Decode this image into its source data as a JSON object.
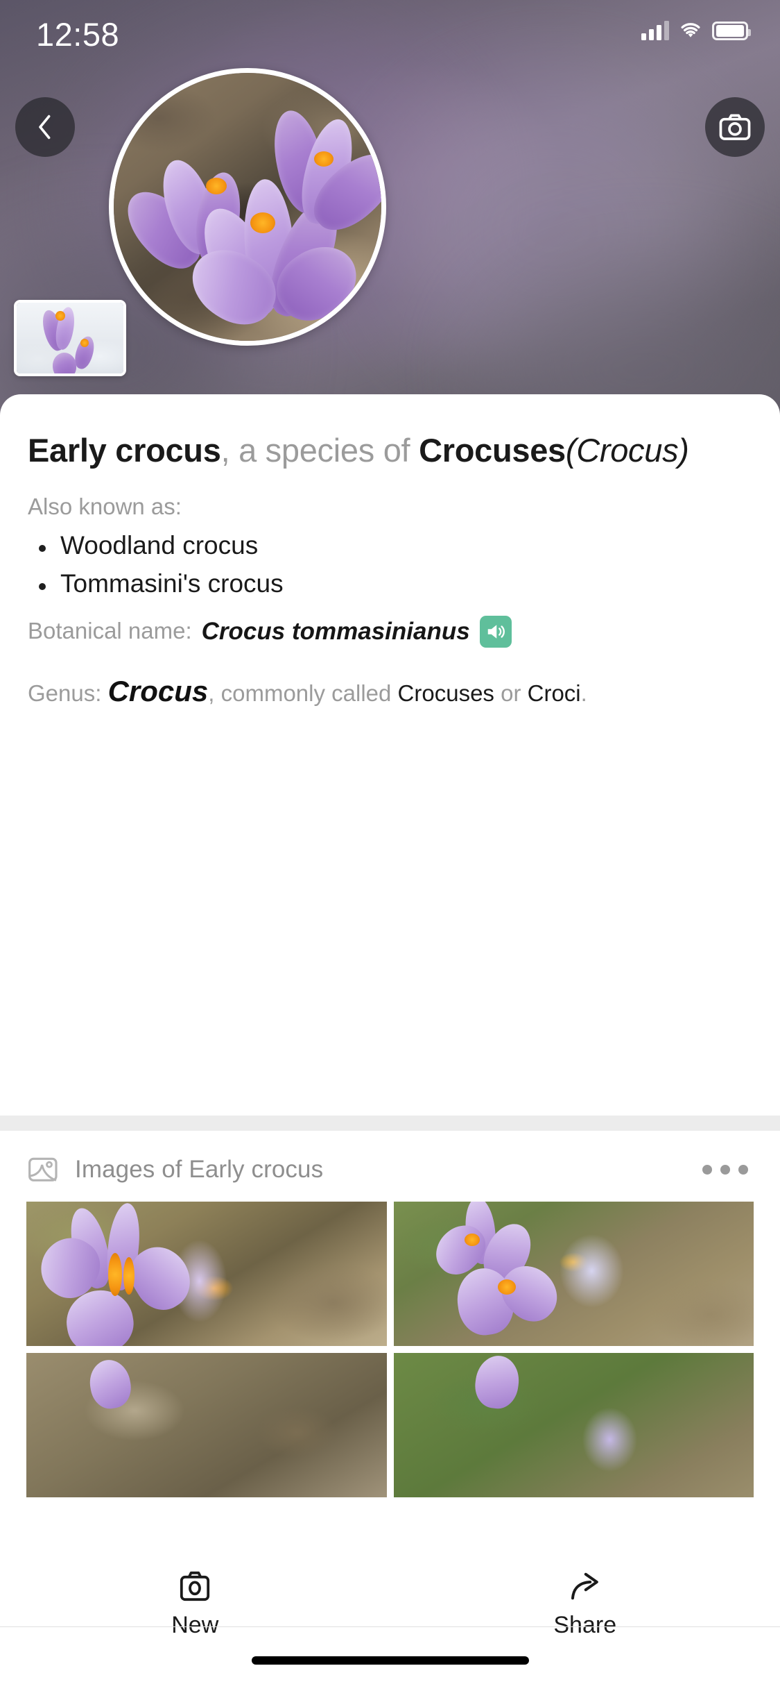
{
  "status_bar": {
    "time": "12:58",
    "cellular_icon": "signal-bars-icon",
    "wifi_icon": "wifi-icon",
    "battery_icon": "battery-full-icon"
  },
  "hero": {
    "back_button_icon": "chevron-left-icon",
    "camera_button_icon": "camera-icon",
    "main_photo_name": "early-crocus-hero-photo",
    "thumbnail_name": "crocus-in-snow-thumbnail"
  },
  "info": {
    "title_name": "Early crocus",
    "title_connector": ", a species of",
    "title_genus_common": "Crocuses",
    "title_genus_scientific": "(Crocus)",
    "aka_label": "Also known as:",
    "aka_items": [
      "Woodland crocus",
      "Tommasini's crocus"
    ],
    "botanical_label": "Botanical name:",
    "botanical_value": "Crocus tommasinianus",
    "audio_icon": "speaker-volume-icon",
    "genus_label": "Genus:",
    "genus_name": "Crocus",
    "genus_mid": ", commonly called ",
    "genus_common_1": "Crocuses",
    "genus_or": " or ",
    "genus_common_2": "Croci",
    "genus_period": "."
  },
  "images_section": {
    "header_icon": "image-placeholder-icon",
    "header_title": "Images of Early crocus",
    "more_icon": "more-horizontal-icon",
    "tiles": [
      {
        "name": "crocus-image-1",
        "alt": "Single purple crocus open on forest floor"
      },
      {
        "name": "crocus-image-2",
        "alt": "Pale lilac crocuses among grass and leaves"
      },
      {
        "name": "crocus-image-3",
        "alt": "Crocus among dry leaves"
      },
      {
        "name": "crocus-image-4",
        "alt": "Crocus buds in green grass"
      }
    ]
  },
  "toolbar": {
    "new_icon": "camera-icon",
    "new_label": "New",
    "share_icon": "share-arrow-icon",
    "share_label": "Share"
  },
  "colors": {
    "accent_green": "#5FBF9B",
    "muted_text": "#9B9B9B",
    "primary_text": "#1A1A1A",
    "divider": "#ECECEC"
  }
}
